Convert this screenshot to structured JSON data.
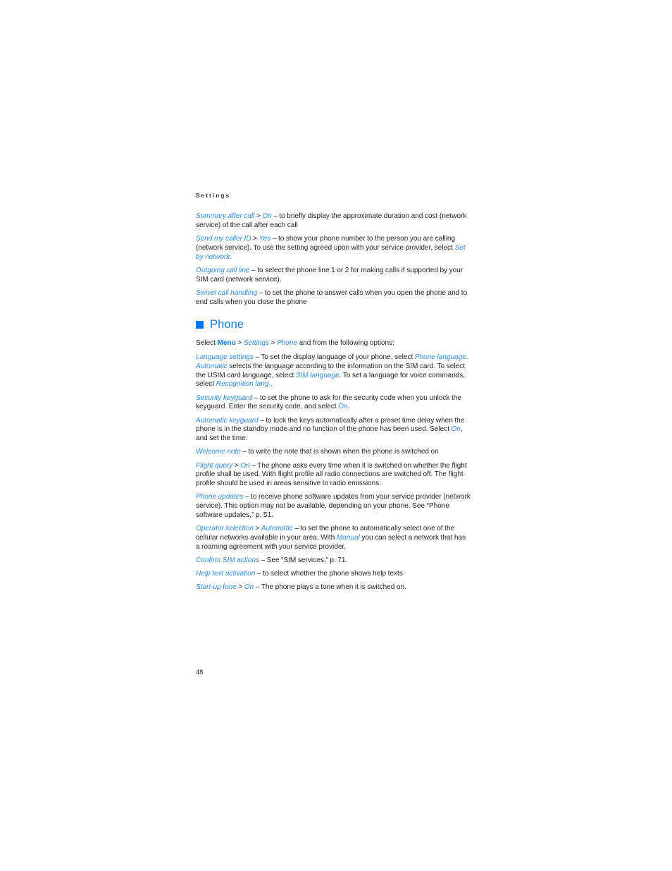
{
  "document": {
    "running_header": "Settings",
    "page_number": "48",
    "colors": {
      "accent_blue": "#0077ee",
      "term_blue": "#2a8ce8",
      "body_text": "#231f20",
      "background": "#ffffff"
    }
  },
  "paragraphs": {
    "summary_after_call": {
      "term": "Summary after call",
      "sep": " > ",
      "value": "On",
      "body": " – to briefly display the approximate duration and cost (network service) of the call after each call"
    },
    "send_my_caller_id": {
      "term": "Send my caller ID",
      "sep": " > ",
      "value": "Yes",
      "body_1": " – to show your phone number to the person you are calling (network service). To use the setting agreed upon with your service provider, select ",
      "value_2": "Set by network",
      "body_2": "."
    },
    "outgoing_call_line": {
      "term": "Outgoing call line",
      "body": " – to select the phone line 1 or 2 for making calls if supported by your SIM card (network service)."
    },
    "swivel_call_handling": {
      "term": "Swivel call handling",
      "body": " – to set the phone to answer calls when you open the phone and to end calls when you close the phone"
    }
  },
  "phone_section": {
    "heading": "Phone",
    "bullet_icon": "filled-square-bullet",
    "select_line": {
      "prefix": "Select ",
      "menu": "Menu",
      "sep_1": " > ",
      "settings": "Settings",
      "sep_2": " > ",
      "phone": "Phone",
      "suffix": " and from the following options:"
    },
    "options": {
      "language_settings": {
        "term": "Language settings",
        "body_1": " – To set the display language of your phone, select ",
        "value_1": "Phone language",
        "body_2": ". ",
        "value_2": "Automatic",
        "body_3": " selects the language according to the information on the SIM card. To select the USIM card language, select ",
        "value_3": "SIM language",
        "body_4": ". To set a language for voice commands, select ",
        "value_4": "Recognition lang.",
        "body_5": "."
      },
      "security_keyguard": {
        "term": "Security keyguard",
        "body_1": " – to set the phone to ask for the security code when you unlock the keyguard. Enter the security code, and select ",
        "value_1": "On",
        "body_2": "."
      },
      "automatic_keyguard": {
        "term": "Automatic keyguard",
        "body_1": " – to lock the keys automatically after a preset time delay when the phone is in the standby mode and no function of the phone has been used. Select ",
        "value_1": "On",
        "body_2": ", and set the time."
      },
      "welcome_note": {
        "term": "Welcome note",
        "body": " – to write the note that is shown when the phone is switched on"
      },
      "flight_query": {
        "term": "Flight query",
        "sep": " > ",
        "value": "On",
        "body": " – The phone asks every time when it is switched on whether the flight profile shall be used. With flight profile all radio connections are switched off. The flight profile should be used in areas sensitive to radio emissions."
      },
      "phone_updates": {
        "term": "Phone updates",
        "body": " – to receive phone software updates from your service provider (network service). This option may not be available, depending on your phone. See “Phone software updates,” p. 51."
      },
      "operator_selection": {
        "term": "Operator selection",
        "sep": " > ",
        "value_1": "Automatic",
        "body_1": " – to set the phone to automatically select one of the cellular networks available in your area. With ",
        "value_2": "Manual",
        "body_2": " you can select a network that has a roaming agreement with your service provider."
      },
      "confirm_sim_actions": {
        "term": "Confirm SIM actions",
        "body": " – See “SIM services,” p. 71."
      },
      "help_text_activation": {
        "term": "Help text activation",
        "body": " – to select whether the phone shows help texts"
      },
      "start_up_tone": {
        "term": "Start-up tone",
        "sep": " > ",
        "value": "On",
        "body": " – The phone plays a tone when it is switched on."
      }
    }
  }
}
